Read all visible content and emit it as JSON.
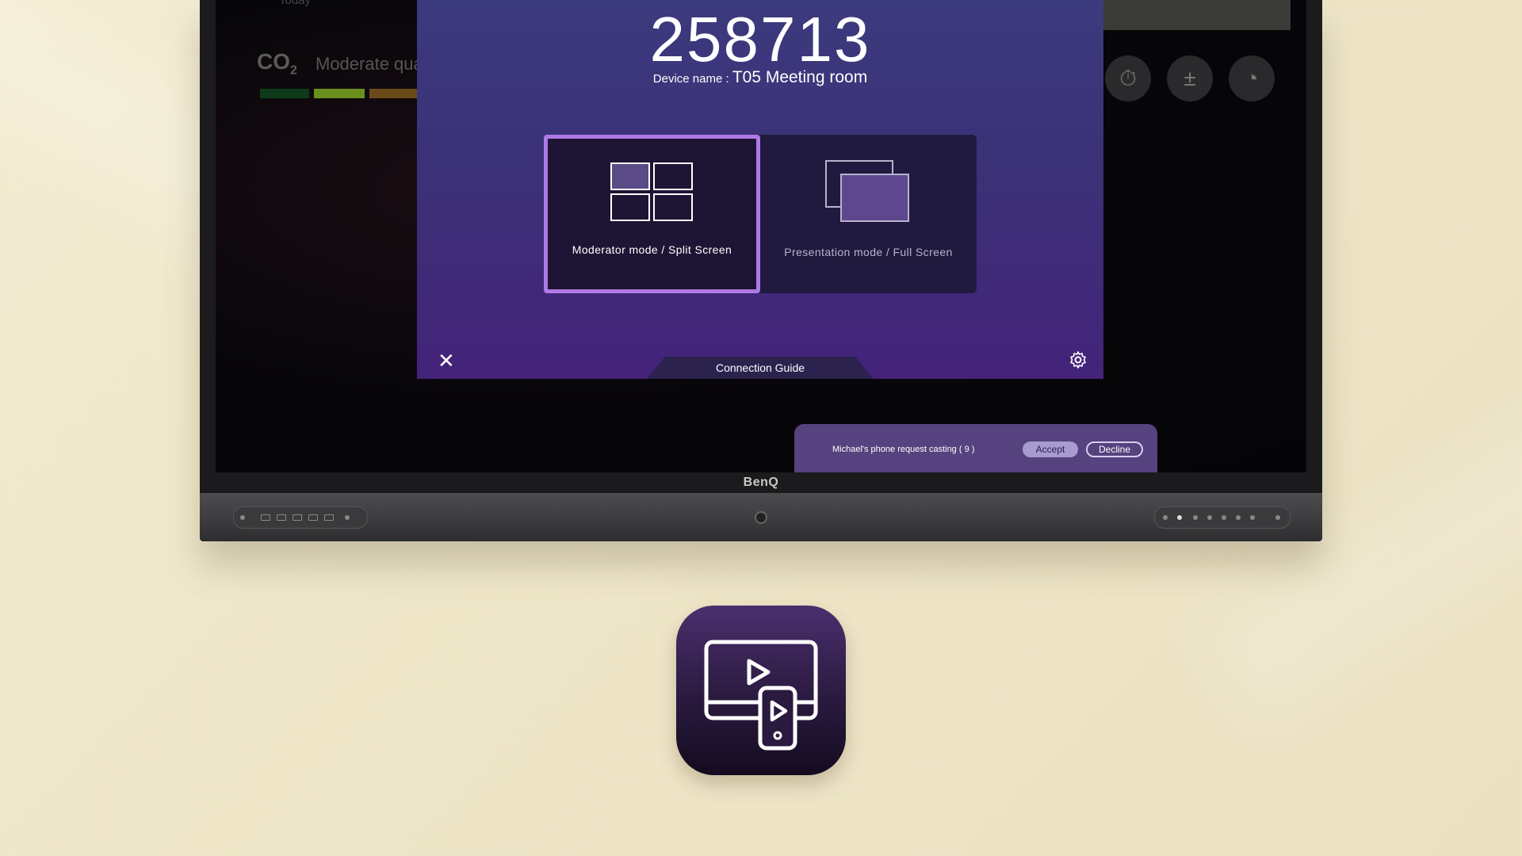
{
  "background": {
    "today_label": "Today",
    "co2_label": "CO",
    "co2_sub": "2",
    "air_quality": "Moderate qua",
    "bar_colors": [
      "#0f3a1a",
      "#6b8f1f",
      "#6b4a1a"
    ]
  },
  "tools": [
    {
      "icon": "timer-icon",
      "glyph": "⏱"
    },
    {
      "icon": "calculator-icon",
      "glyph": "±"
    },
    {
      "icon": "countdown-icon",
      "glyph": "◔"
    }
  ],
  "dialog": {
    "pin_code": "258713",
    "device_label": "Device name : ",
    "device_name": "T05 Meeting room",
    "modes": [
      {
        "label": "Moderator mode / Split Screen",
        "selected": true
      },
      {
        "label": "Presentation mode / Full Screen",
        "selected": false
      }
    ],
    "close_glyph": "✕",
    "connection_guide": "Connection Guide",
    "accent": "#b07ae6"
  },
  "cast_request": {
    "message": "Michael's phone request casting ( 9 )",
    "accept_label": "Accept",
    "decline_label": "Decline"
  },
  "brand": "BenQ"
}
